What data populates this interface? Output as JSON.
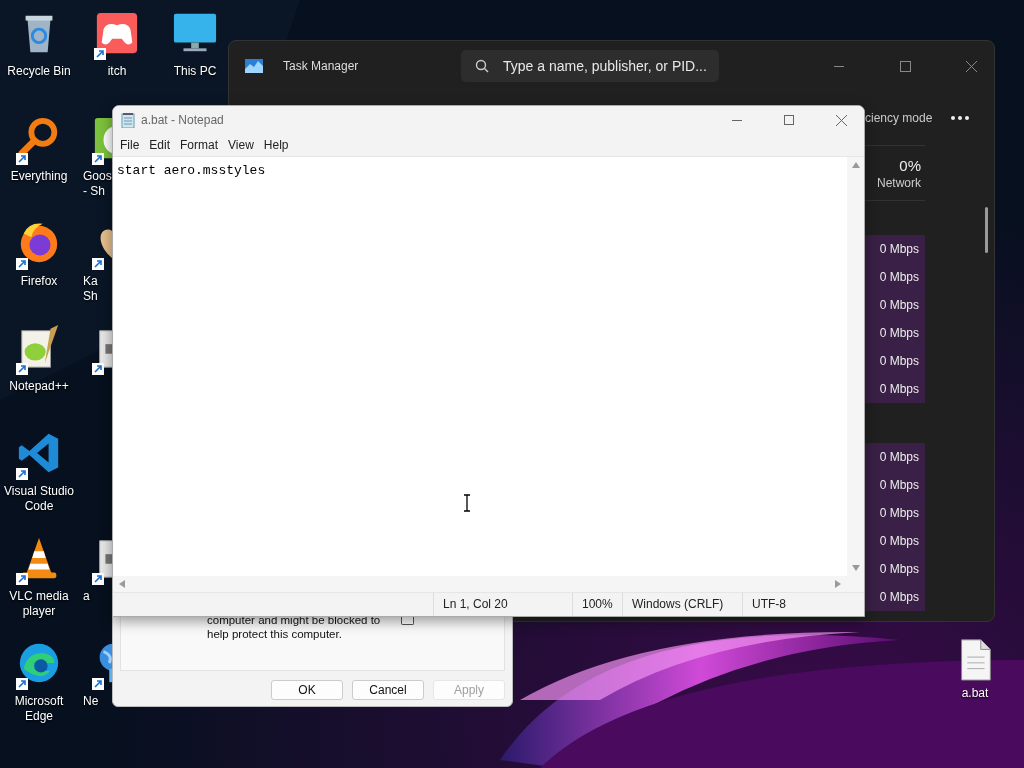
{
  "desktop": {
    "columns": [
      [
        {
          "label": "Recycle Bin",
          "kind": "recycle"
        },
        {
          "label": "Everything",
          "kind": "magnifier"
        },
        {
          "label": "Firefox",
          "kind": "firefox"
        },
        {
          "label": "Notepad++",
          "kind": "notepadpp"
        },
        {
          "label": "Visual Studio Code",
          "kind": "vscode"
        },
        {
          "label": "VLC media player",
          "kind": "cone"
        },
        {
          "label": "Microsoft Edge",
          "kind": "edge"
        }
      ],
      [
        {
          "label": "itch",
          "kind": "gamepad"
        },
        {
          "label": "Goos\n- Sh",
          "kind": "goose"
        },
        {
          "label": "Ka\nSh",
          "kind": "heart"
        },
        {
          "kind": "document"
        },
        {
          "kind": "gap"
        },
        {
          "label": "a",
          "kind": "document"
        },
        {
          "label": "Ne",
          "kind": "globe"
        }
      ],
      [
        {
          "label": "This PC",
          "kind": "monitor"
        }
      ]
    ],
    "right_icons": [
      {
        "label": "a.bat",
        "kind": "file"
      }
    ]
  },
  "task_manager": {
    "title": "Task Manager",
    "search": {
      "placeholder": "Type a name, publisher, or PID..."
    },
    "toolbar_text": "ciency mode",
    "network_header": {
      "percent": "0%",
      "label": "Network"
    },
    "groups": [
      [
        "0 Mbps",
        "0 Mbps",
        "0 Mbps",
        "0 Mbps",
        "0 Mbps",
        "0 Mbps"
      ],
      [
        "0 Mbps",
        "0 Mbps",
        "0 Mbps",
        "0 Mbps",
        "0 Mbps",
        "0 Mbps"
      ]
    ]
  },
  "dialog": {
    "message": "computer and might be blocked to help protect this computer.",
    "unblock_checked": false,
    "buttons": [
      {
        "label": "OK",
        "disabled": false
      },
      {
        "label": "Cancel",
        "disabled": false
      },
      {
        "label": "Apply",
        "disabled": true
      }
    ]
  },
  "notepad": {
    "title": "a.bat - Notepad",
    "menu": [
      "File",
      "Edit",
      "Format",
      "View",
      "Help"
    ],
    "content": "start aero.msstyles",
    "status": [
      "Ln 1, Col 20",
      "100%",
      "Windows (CRLF)",
      "UTF-8"
    ]
  }
}
